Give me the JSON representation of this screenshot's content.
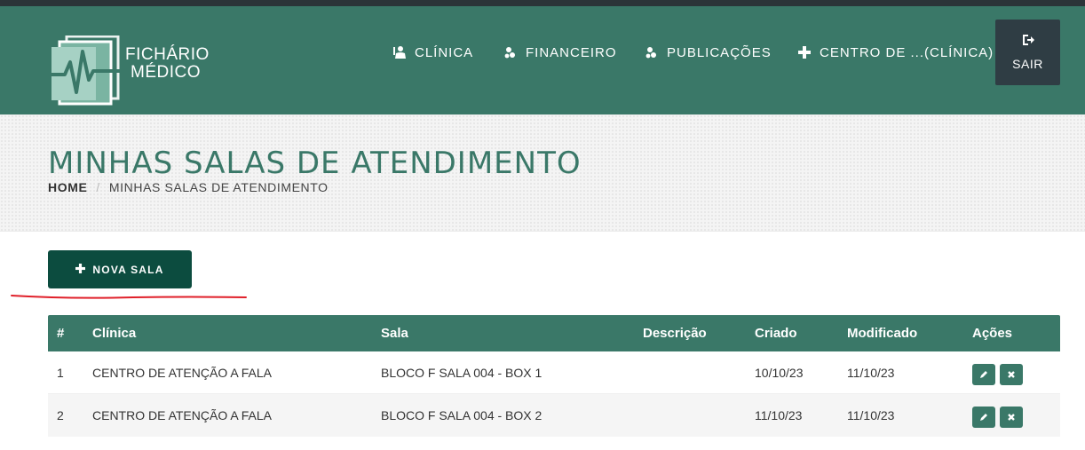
{
  "brand": {
    "line1": "FICHÁRIO",
    "line2": "MÉDICO"
  },
  "nav": {
    "items": [
      {
        "label": "CLÍNICA",
        "icon": "user-md-icon"
      },
      {
        "label": "FINANCEIRO",
        "icon": "coins-icon"
      },
      {
        "label": "PUBLICAÇÕES",
        "icon": "coins-icon"
      },
      {
        "label": "CENTRO DE ...(CLÍNICA)",
        "icon": "plus-icon"
      }
    ],
    "logout_label": "SAIR"
  },
  "page": {
    "title": "MINHAS SALAS DE ATENDIMENTO",
    "breadcrumb": {
      "home": "HOME",
      "sep": "/",
      "current": "MINHAS SALAS DE ATENDIMENTO"
    }
  },
  "actions": {
    "new_room_label": "NOVA SALA"
  },
  "table": {
    "headers": [
      "#",
      "Clínica",
      "Sala",
      "Descrição",
      "Criado",
      "Modificado",
      "Ações"
    ],
    "rows": [
      {
        "num": "1",
        "clinica": "CENTRO DE ATENÇÃO A FALA",
        "sala": "BLOCO F SALA 004 - BOX 1",
        "descricao": "",
        "criado": "10/10/23",
        "modificado": "11/10/23"
      },
      {
        "num": "2",
        "clinica": "CENTRO DE ATENÇÃO A FALA",
        "sala": "BLOCO F SALA 004 - BOX 2",
        "descricao": "",
        "criado": "11/10/23",
        "modificado": "11/10/23"
      }
    ]
  },
  "colors": {
    "primary": "#3a7868",
    "dark_button": "#0c4c3f",
    "logout_bg": "#2f3d44",
    "annotation_red": "#e0202a"
  }
}
